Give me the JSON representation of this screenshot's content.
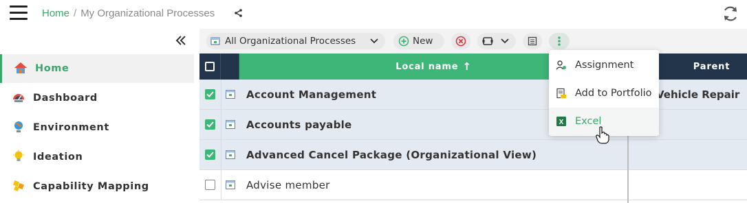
{
  "header": {
    "breadcrumb": {
      "home": "Home",
      "separator": "/",
      "current": "My Organizational Processes"
    }
  },
  "sidebar": {
    "items": [
      {
        "label": "Home",
        "icon": "home-icon",
        "active": true
      },
      {
        "label": "Dashboard",
        "icon": "dashboard-icon",
        "active": false
      },
      {
        "label": "Environment",
        "icon": "environment-icon",
        "active": false
      },
      {
        "label": "Ideation",
        "icon": "lightbulb-icon",
        "active": false
      },
      {
        "label": "Capability Mapping",
        "icon": "capability-icon",
        "active": false
      }
    ]
  },
  "toolbar": {
    "view_select": "All Organizational Processes",
    "new_label": "New"
  },
  "table": {
    "columns": {
      "local_name": "Local name",
      "sort_indicator": "↑",
      "parent": "Parent"
    },
    "rows": [
      {
        "name": "Account Management",
        "parent": "Vehicle Repair",
        "checked": true
      },
      {
        "name": "Accounts payable",
        "parent": "",
        "checked": true
      },
      {
        "name": "Advanced Cancel Package (Organizational View)",
        "parent": "",
        "checked": true
      },
      {
        "name": "Advise member",
        "parent": "",
        "checked": false
      }
    ]
  },
  "menu": {
    "items": [
      {
        "label": "Assignment",
        "icon": "user-assign-icon"
      },
      {
        "label": "Add to Portfolio",
        "icon": "portfolio-icon"
      },
      {
        "label": "Excel",
        "icon": "excel-icon"
      }
    ]
  },
  "colors": {
    "accent": "#3db677",
    "header_dark": "#22354a",
    "selected_row": "#e4eaf1"
  }
}
